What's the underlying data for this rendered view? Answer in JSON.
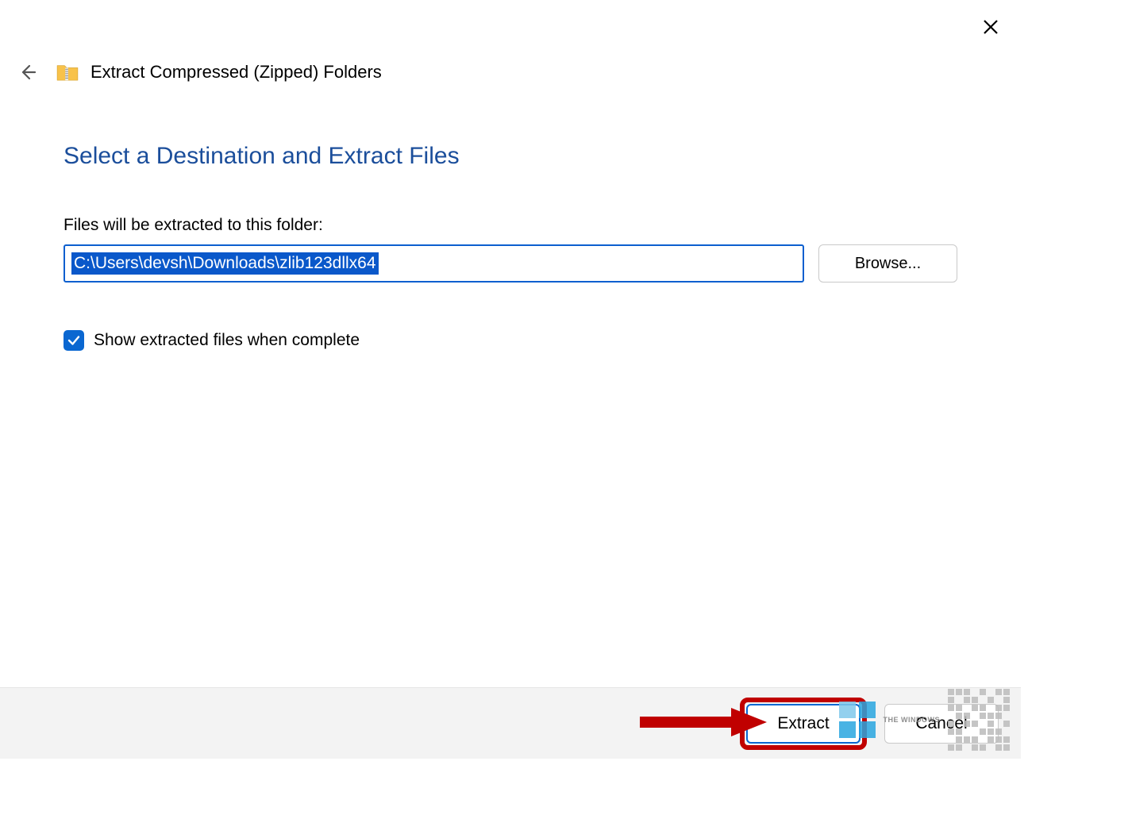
{
  "window": {
    "title": "Extract Compressed (Zipped) Folders"
  },
  "page": {
    "heading": "Select a Destination and Extract Files",
    "path_label": "Files will be extracted to this folder:",
    "path_value": "C:\\Users\\devsh\\Downloads\\zlib123dllx64",
    "browse_label": "Browse...",
    "checkbox_label": "Show extracted files when complete",
    "checkbox_checked": true
  },
  "footer": {
    "extract_label": "Extract",
    "cancel_label": "Cancel"
  },
  "watermark": {
    "text": "THE WINDOWS"
  }
}
